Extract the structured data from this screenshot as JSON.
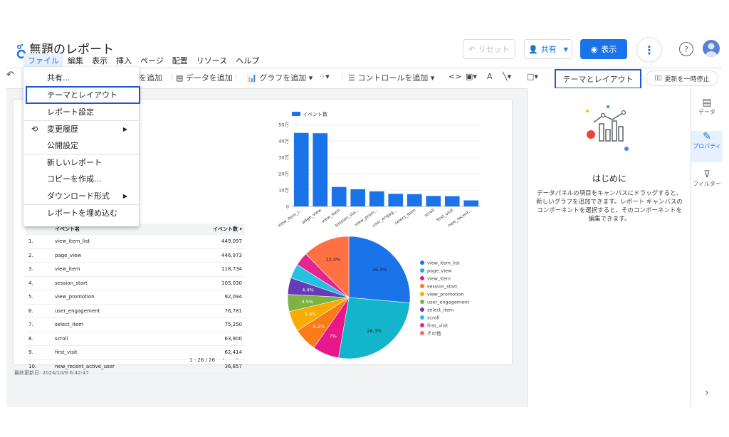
{
  "app": {
    "title": "無題のレポート",
    "menu": [
      "ファイル",
      "編集",
      "表示",
      "挿入",
      "ページ",
      "配置",
      "リソース",
      "ヘルプ"
    ],
    "buttons": {
      "reset": "リセット",
      "share": "共有",
      "view": "表示"
    }
  },
  "toolbar": {
    "add_page_partial": "を追加",
    "add_data": "データを追加",
    "add_chart": "グラフを追加",
    "add_control": "コントロールを追加",
    "theme_layout": "テーマとレイアウト",
    "pause_update": "更新を一時停止"
  },
  "file_menu": {
    "items": [
      {
        "label": "共有..."
      },
      {
        "label": "テーマとレイアウト"
      },
      {
        "label": "レポート設定"
      },
      {
        "label": "変更履歴"
      },
      {
        "label": "公開設定"
      },
      {
        "label": "新しいレポート"
      },
      {
        "label": "コピーを作成..."
      },
      {
        "label": "ダウンロード形式"
      },
      {
        "label": "レポートを埋め込む"
      }
    ]
  },
  "table": {
    "headers": [
      "イベント名",
      "イベント数 ▾"
    ],
    "rows": [
      {
        "n": "1.",
        "name": "view_item_list",
        "count": "449,097"
      },
      {
        "n": "2.",
        "name": "page_view",
        "count": "446,973"
      },
      {
        "n": "3.",
        "name": "view_item",
        "count": "118,734"
      },
      {
        "n": "4.",
        "name": "session_start",
        "count": "105,030"
      },
      {
        "n": "5.",
        "name": "view_promotion",
        "count": "92,094"
      },
      {
        "n": "6.",
        "name": "user_engagement",
        "count": "76,781"
      },
      {
        "n": "7.",
        "name": "select_item",
        "count": "75,250"
      },
      {
        "n": "8.",
        "name": "scroll",
        "count": "63,900"
      },
      {
        "n": "9.",
        "name": "first_visit",
        "count": "62,414"
      },
      {
        "n": "10.",
        "name": "new_recent_active_user",
        "count": "36,857"
      }
    ],
    "pagination": "1 - 26 / 26"
  },
  "last_updated": "最終更新日: 2024/10/9 6:42:47",
  "right_panel": {
    "heading": "はじめに",
    "description": "データパネルの項目をキャンバスにドラッグすると、新しいグラフを追加できます。レポート キャンバスのコンポーネントを選択すると、そのコンポーネントを編集できます。"
  },
  "right_nav": [
    "データ",
    "プロパティ",
    "フィルター"
  ],
  "colors": {
    "accent": "#1a73e8",
    "bar": "#1a73e8",
    "highlight": "#1a56db"
  },
  "chart_data": [
    {
      "type": "bar",
      "legend": "イベント数",
      "categories": [
        "view_item_l...",
        "page_view",
        "view_item",
        "session_sta...",
        "view_prom...",
        "user_engag...",
        "select_item",
        "scroll",
        "first_visit",
        "new_recent..."
      ],
      "values": [
        449097,
        446973,
        118734,
        105030,
        92094,
        76781,
        75250,
        63900,
        62414,
        36857
      ],
      "ylim": [
        0,
        500000
      ],
      "yticks": [
        "0",
        "10万",
        "20万",
        "30万",
        "40万",
        "50万"
      ]
    },
    {
      "type": "pie",
      "slices": [
        {
          "name": "view_item_list",
          "pct": 26.4,
          "label": "26.4%",
          "color": "#1a73e8"
        },
        {
          "name": "page_view",
          "pct": 26.3,
          "label": "26.3%",
          "color": "#12b5cb"
        },
        {
          "name": "view_item",
          "pct": 7.0,
          "label": "7%",
          "color": "#e8178a"
        },
        {
          "name": "session_start",
          "pct": 6.2,
          "label": "6.2%",
          "color": "#fa7b17"
        },
        {
          "name": "view_promotion",
          "pct": 5.4,
          "label": "5.4%",
          "color": "#f9ab00"
        },
        {
          "name": "user_engagement",
          "pct": 4.5,
          "label": "4.5%",
          "color": "#7cb342"
        },
        {
          "name": "select_item",
          "pct": 4.4,
          "label": "4.4%",
          "color": "#673ab7"
        },
        {
          "name": "scroll",
          "pct": 3.8,
          "label": "",
          "color": "#24c1e0"
        },
        {
          "name": "first_visit",
          "pct": 3.6,
          "label": "",
          "color": "#e52592"
        },
        {
          "name": "その他",
          "pct": 12.4,
          "label": "12.4%",
          "color": "#ff7043"
        }
      ]
    }
  ]
}
